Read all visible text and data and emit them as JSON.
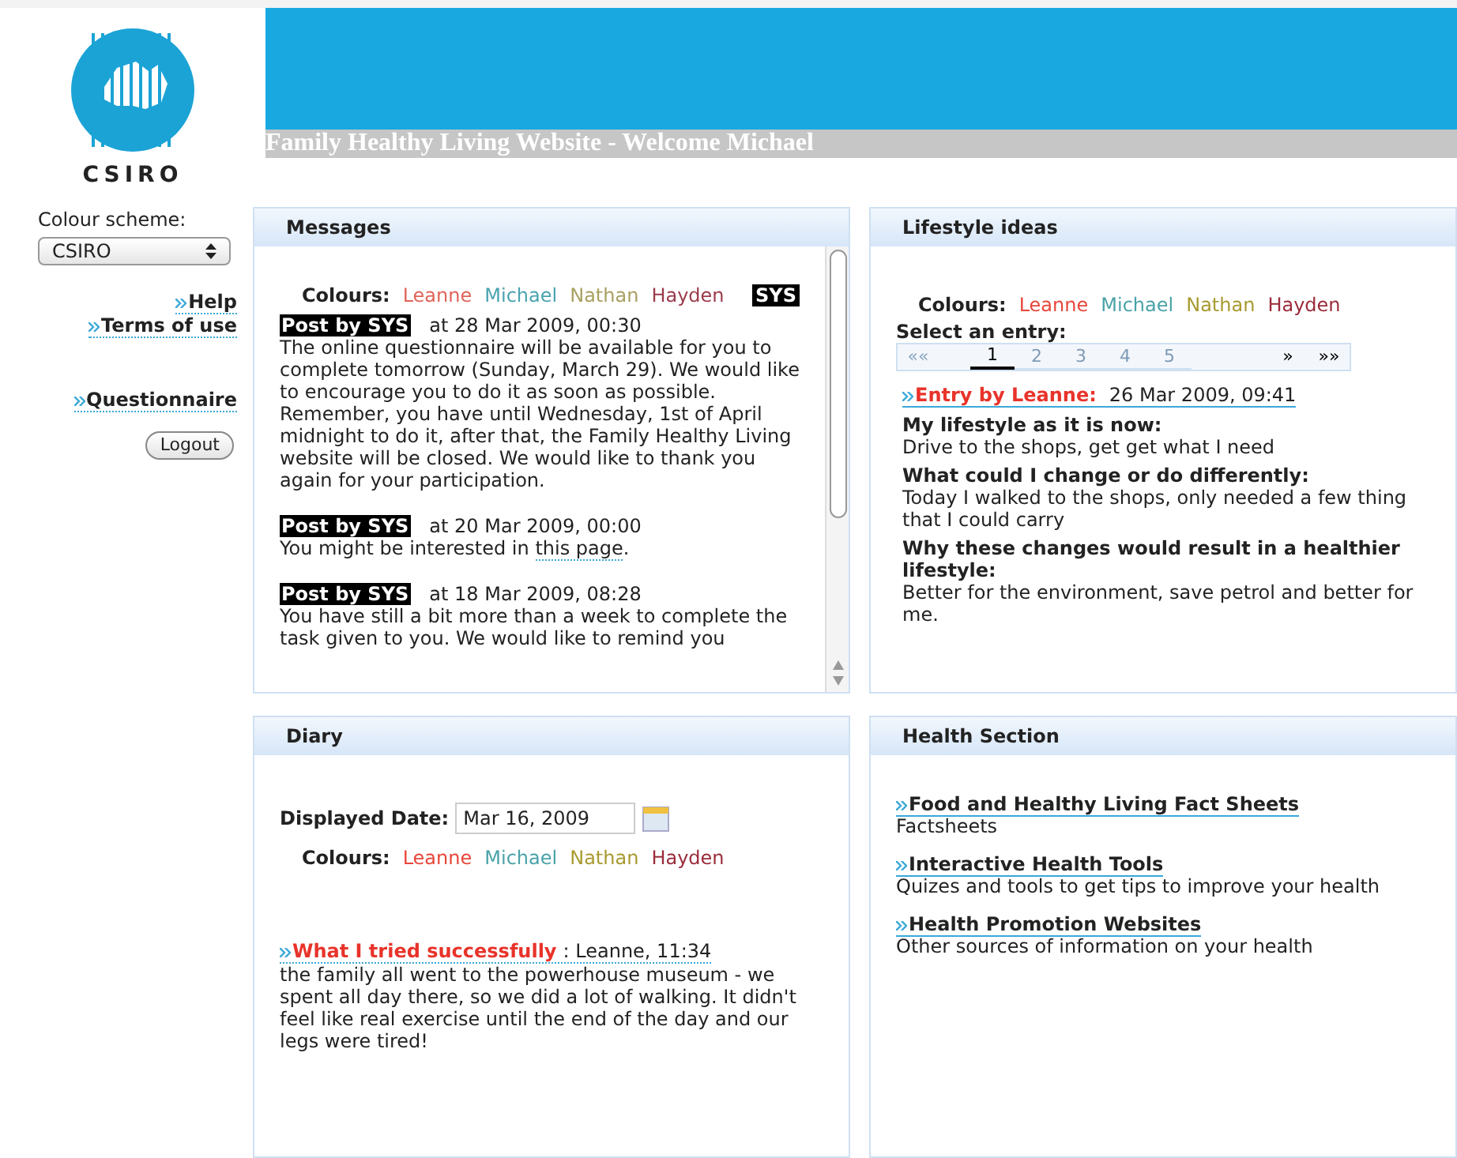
{
  "logo": {
    "text": "CSIRO"
  },
  "header": {
    "title": "Family Healthy Living Website - Welcome Michael"
  },
  "sidebar": {
    "scheme_label": "Colour scheme:",
    "scheme_value": "CSIRO",
    "links": [
      "Help",
      "Terms of use"
    ],
    "questionnaire": "Questionnaire",
    "logout": "Logout"
  },
  "messages": {
    "title": "Messages",
    "colours_label": "Colours:",
    "colours": [
      {
        "name": "Leanne",
        "color": "#e0645a"
      },
      {
        "name": "Michael",
        "color": "#4aa3b0"
      },
      {
        "name": "Nathan",
        "color": "#a8a060"
      },
      {
        "name": "Hayden",
        "color": "#9b3b4a"
      }
    ],
    "sys_tag": "SYS",
    "posts": [
      {
        "tag": "Post by SYS",
        "date": "at 28 Mar 2009, 00:30",
        "body": "The online questionnaire will be available for you to complete tomorrow (Sunday, March 29). We would like to encourage you to do it as soon as possible. Remember, you have until Wednesday, 1st of April midnight to do it, after that, the Family Healthy Living website will be closed. We would like to thank you again for your participation."
      },
      {
        "tag": "Post by SYS",
        "date": "at 20 Mar 2009, 00:00",
        "body": "You might be interested in ",
        "link": "this page",
        "after": "."
      },
      {
        "tag": "Post by SYS",
        "date": "at 18 Mar 2009, 08:28",
        "body": "You have still a bit more than a week to complete the task given to you. We would like to remind you"
      }
    ]
  },
  "lifestyle": {
    "title": "Lifestyle ideas",
    "colours_label": "Colours:",
    "colours": [
      {
        "name": "Leanne",
        "color": "#e8463a"
      },
      {
        "name": "Michael",
        "color": "#4aa3a8"
      },
      {
        "name": "Nathan",
        "color": "#a89a30"
      },
      {
        "name": "Hayden",
        "color": "#9b2b3a"
      }
    ],
    "select_label": "Select an entry:",
    "pager": [
      {
        "kind": "nav",
        "label": "««",
        "disabled": true
      },
      {
        "kind": "page",
        "label": "1",
        "selected": true
      },
      {
        "kind": "page",
        "label": "2",
        "selected": false
      },
      {
        "kind": "page",
        "label": "3",
        "selected": false
      },
      {
        "kind": "page",
        "label": "4",
        "selected": false
      },
      {
        "kind": "page",
        "label": "5",
        "selected": false
      },
      {
        "kind": "nav",
        "label": "»",
        "disabled": false
      },
      {
        "kind": "nav",
        "label": "»»",
        "disabled": false
      }
    ],
    "entry": {
      "heading": "Entry by Leanne:",
      "date": "26 Mar 2009, 09:41",
      "color": "#e8332a"
    },
    "sections": [
      {
        "question": "My lifestyle as it is now:",
        "answer": "Drive to the shops, get get what I need"
      },
      {
        "question": "What could I change or do differently:",
        "answer": "Today I walked to the shops, only needed a few thing that I could carry"
      },
      {
        "question": "Why these changes would result in a healthier lifestyle:",
        "answer": "Better for the environment, save petrol and better for me."
      }
    ]
  },
  "diary": {
    "title": "Diary",
    "date_label": "Displayed Date:",
    "date_value": "Mar 16, 2009",
    "colours_label": "Colours:",
    "colours": [
      {
        "name": "Leanne",
        "color": "#e8463a"
      },
      {
        "name": "Michael",
        "color": "#4aa3a8"
      },
      {
        "name": "Nathan",
        "color": "#a89a30"
      },
      {
        "name": "Hayden",
        "color": "#9b2b3a"
      }
    ],
    "entry": {
      "heading": "What I tried successfully",
      "meta": ": Leanne, 11:34",
      "color": "#e8332a",
      "body": "the family all went to the powerhouse museum - we spent all day there, so we did a lot of walking. It didn't feel like real exercise until the end of the day and our legs were tired!"
    }
  },
  "health": {
    "title": "Health Section",
    "items": [
      {
        "link": "Food and Healthy Living Fact Sheets",
        "desc": "Factsheets"
      },
      {
        "link": "Interactive Health Tools",
        "desc": "Quizes and tools to get tips to improve your health"
      },
      {
        "link": "Health Promotion Websites",
        "desc": "Other sources of information on your health"
      }
    ]
  }
}
